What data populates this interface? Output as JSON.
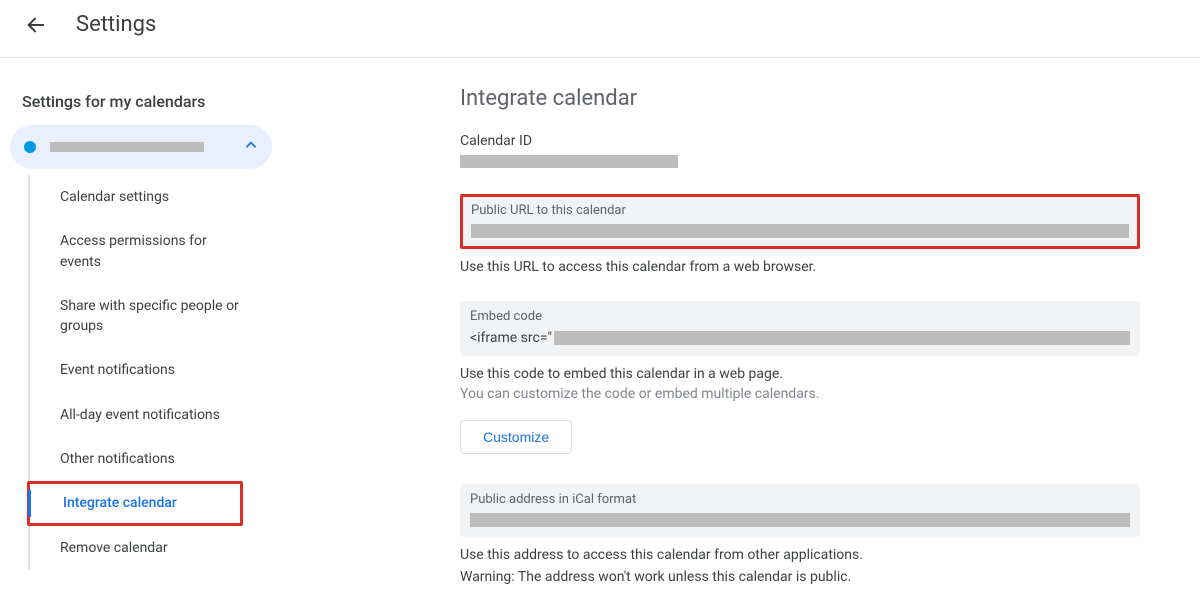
{
  "header": {
    "title": "Settings"
  },
  "sidebar": {
    "heading": "Settings for my calendars",
    "items": [
      {
        "label": "Calendar settings"
      },
      {
        "label": "Access permissions for events"
      },
      {
        "label": "Share with specific people or groups"
      },
      {
        "label": "Event notifications"
      },
      {
        "label": "All-day event notifications"
      },
      {
        "label": "Other notifications"
      },
      {
        "label": "Integrate calendar"
      },
      {
        "label": "Remove calendar"
      }
    ]
  },
  "main": {
    "section_title": "Integrate calendar",
    "calendar_id_label": "Calendar ID",
    "public_url_label": "Public URL to this calendar",
    "public_url_help": "Use this URL to access this calendar from a web browser.",
    "embed_label": "Embed code",
    "embed_prefix": "<iframe src=\"",
    "embed_help1": "Use this code to embed this calendar in a web page.",
    "embed_help2": "You can customize the code or embed multiple calendars.",
    "customize_btn": "Customize",
    "ical_label": "Public address in iCal format",
    "ical_help": "Use this address to access this calendar from other applications.",
    "ical_warning": "Warning: The address won't work unless this calendar is public."
  }
}
